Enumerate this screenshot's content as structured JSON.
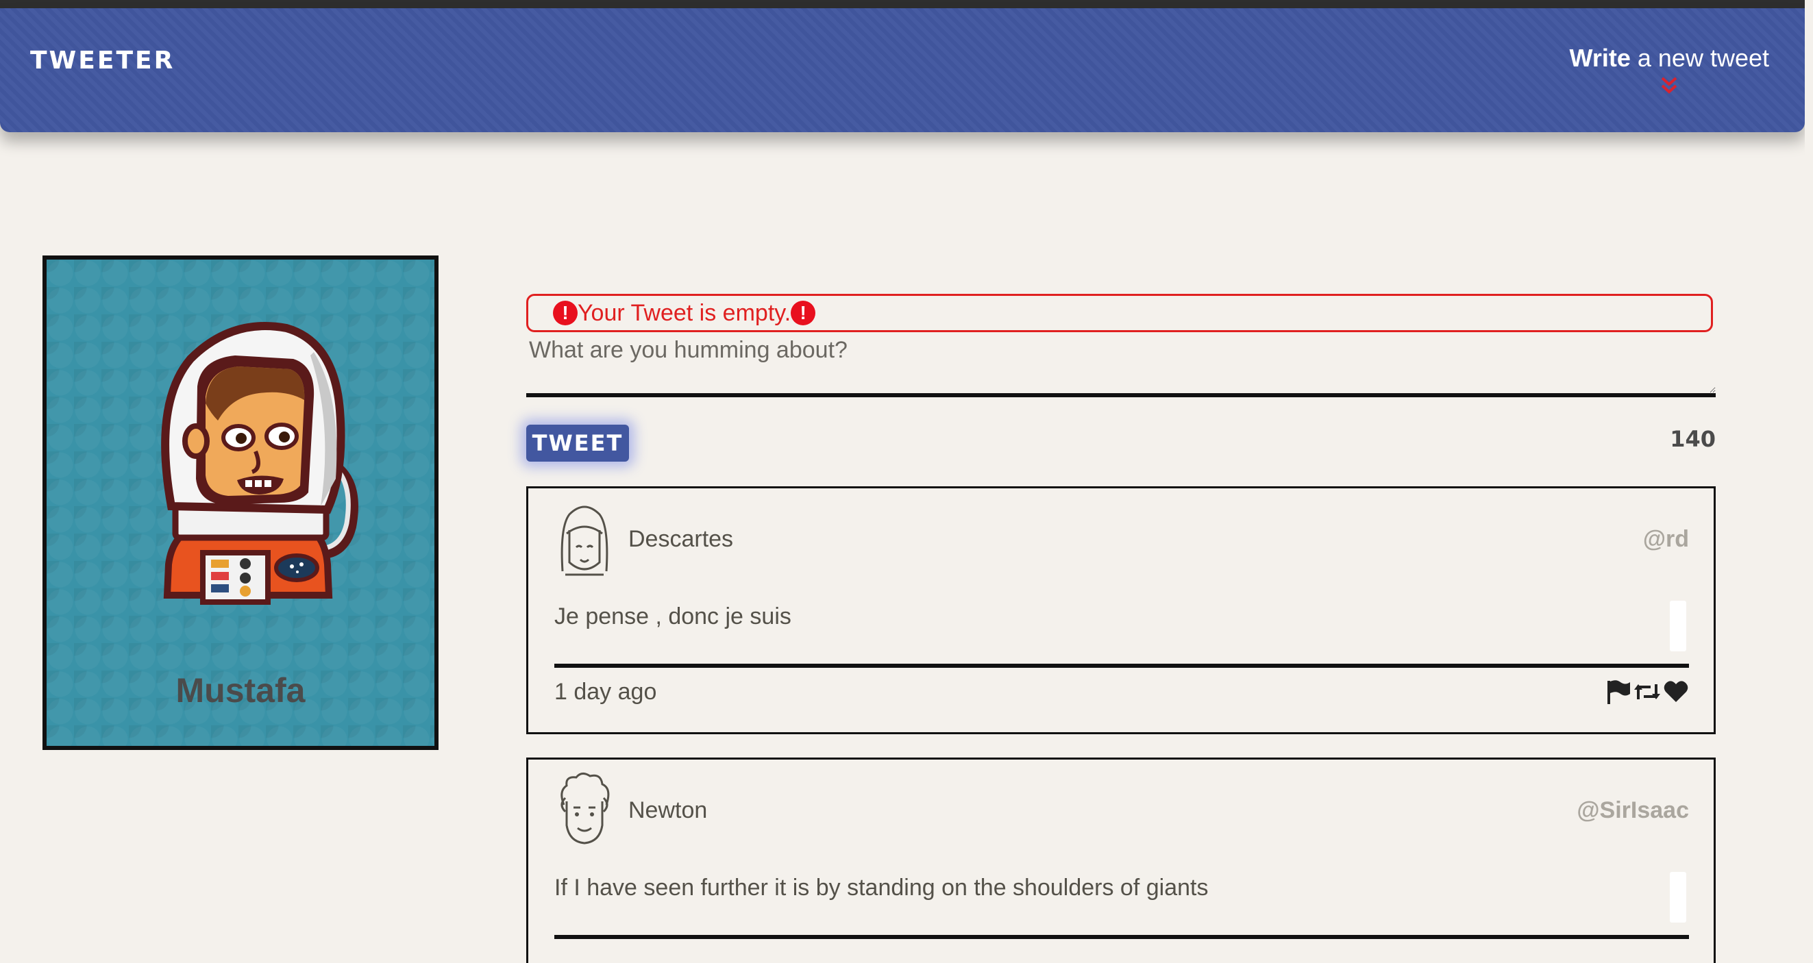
{
  "nav": {
    "brand": "TWEETER",
    "compose_bold": "Write",
    "compose_rest": " a new tweet",
    "compose_icon": "double-chevron-down-icon"
  },
  "profile": {
    "name": "Mustafa",
    "avatar": "astronaut-avatar"
  },
  "new_tweet": {
    "error_text": "Your Tweet is empty.",
    "placeholder": "What are you humming about?",
    "button_label": "TWEET",
    "counter": "140"
  },
  "tweets": [
    {
      "name": "Descartes",
      "handle": "@rd",
      "text": "Je pense , donc je suis",
      "time": "1 day ago",
      "avatar": "girl-face-avatar"
    },
    {
      "name": "Newton",
      "handle": "@SirIsaac",
      "text": "If I have seen further it is by standing on the shoulders of giants",
      "avatar": "curly-hair-face-avatar"
    }
  ],
  "colors": {
    "nav": "#4257a0",
    "error": "#e02020",
    "profile_bg": "#3a93a8",
    "page_bg": "#f4f1ec"
  }
}
